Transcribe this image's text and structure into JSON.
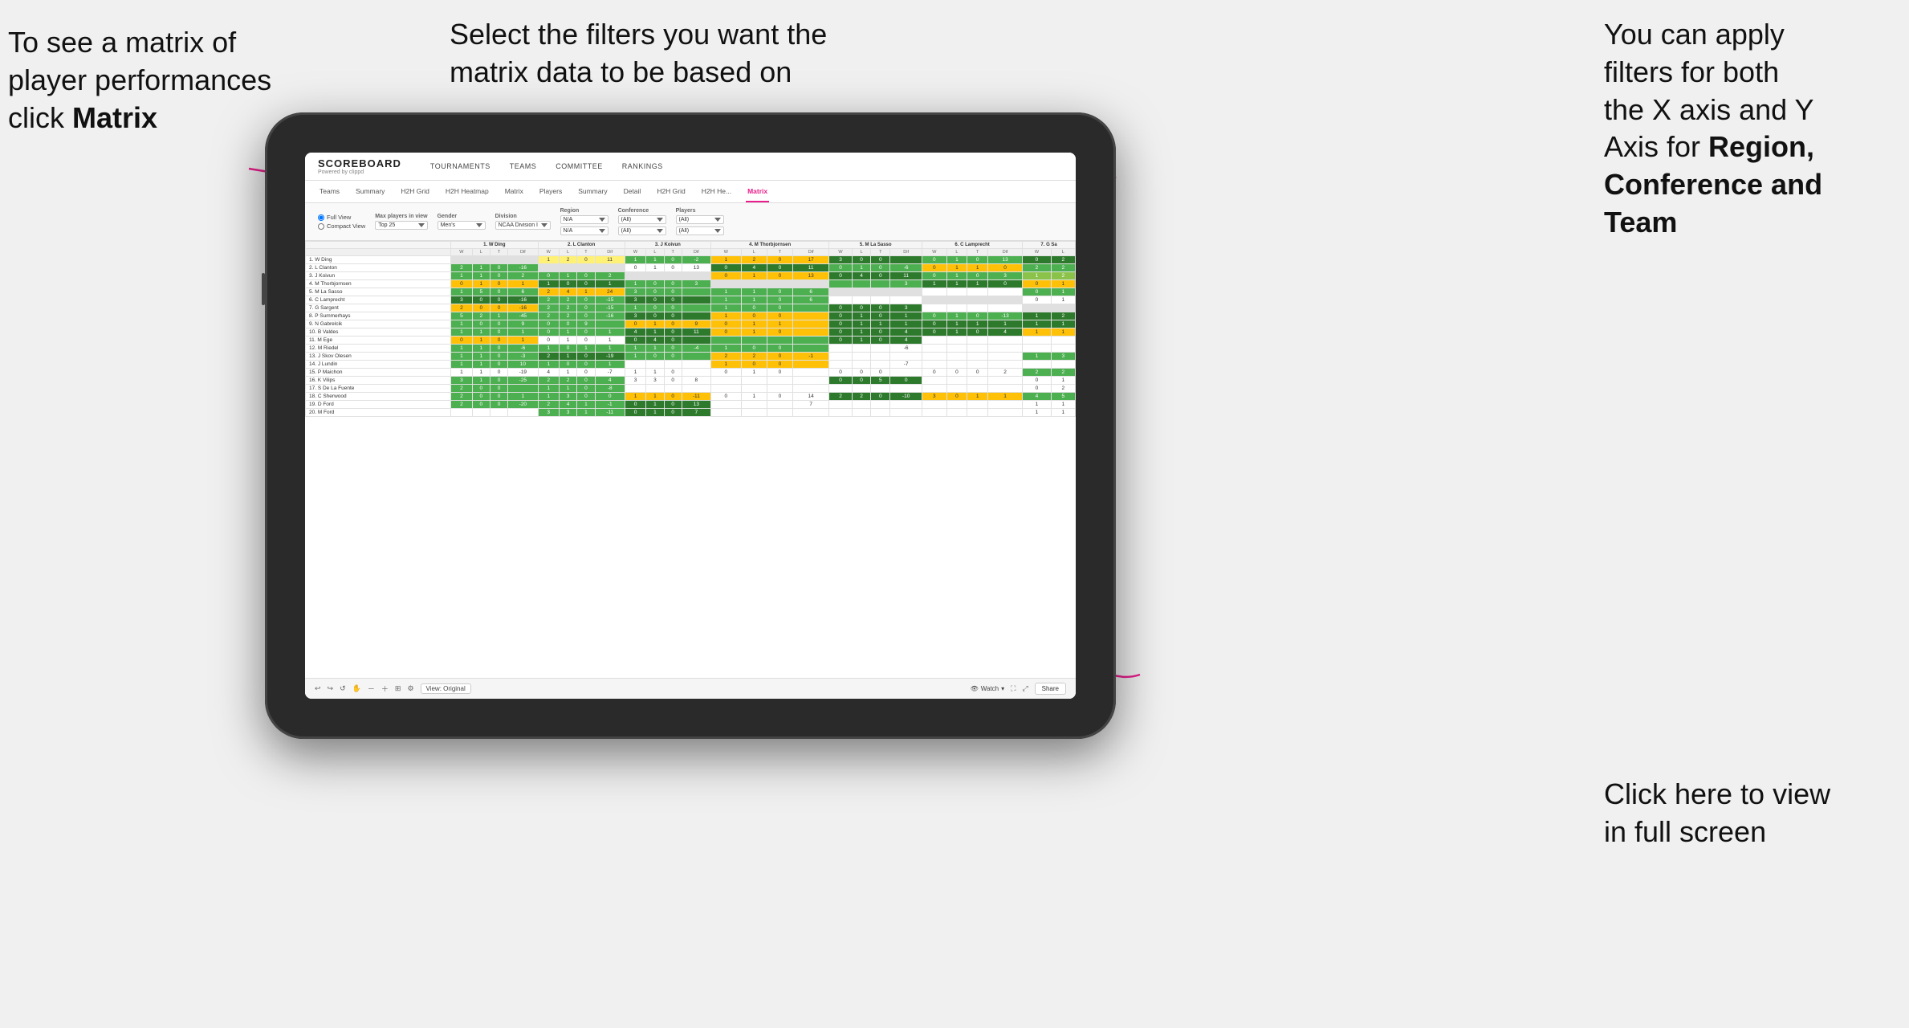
{
  "annotations": {
    "top_left": {
      "line1": "To see a matrix of",
      "line2": "player performances",
      "line3_prefix": "click ",
      "line3_bold": "Matrix"
    },
    "top_center": {
      "text": "Select the filters you want the matrix data to be based on"
    },
    "top_right": {
      "line1": "You  can apply",
      "line2": "filters for both",
      "line3": "the X axis and Y",
      "line4_prefix": "Axis for ",
      "line4_bold": "Region,",
      "line5_bold": "Conference and",
      "line6_bold": "Team"
    },
    "bottom_right": {
      "line1": "Click here to view",
      "line2": "in full screen"
    }
  },
  "nav": {
    "logo": "SCOREBOARD",
    "logo_sub": "Powered by clippd",
    "items": [
      "TOURNAMENTS",
      "TEAMS",
      "COMMITTEE",
      "RANKINGS"
    ]
  },
  "sub_nav": {
    "items": [
      "Teams",
      "Summary",
      "H2H Grid",
      "H2H Heatmap",
      "Matrix",
      "Players",
      "Summary",
      "Detail",
      "H2H Grid",
      "H2H He...",
      "Matrix"
    ],
    "active": "Matrix"
  },
  "filters": {
    "view_options": [
      "Full View",
      "Compact View"
    ],
    "active_view": "Full View",
    "max_players_label": "Max players in view",
    "max_players_value": "Top 25",
    "gender_label": "Gender",
    "gender_value": "Men's",
    "division_label": "Division",
    "division_value": "NCAA Division I",
    "region_label": "Region",
    "region_values": [
      "N/A",
      "N/A"
    ],
    "conference_label": "Conference",
    "conference_values": [
      "(All)",
      "(All)"
    ],
    "players_label": "Players",
    "players_values": [
      "(All)",
      "(All)"
    ]
  },
  "matrix": {
    "col_headers": [
      "1. W Ding",
      "2. L Clanton",
      "3. J Koivun",
      "4. M Thorbjornsen",
      "5. M La Sasso",
      "6. C Lamprecht",
      "7. G Sa"
    ],
    "sub_headers": [
      "W",
      "L",
      "T",
      "Dif"
    ],
    "rows": [
      {
        "name": "1. W Ding"
      },
      {
        "name": "2. L Clanton"
      },
      {
        "name": "3. J Koivun"
      },
      {
        "name": "4. M Thorbjornsen"
      },
      {
        "name": "5. M La Sasso"
      },
      {
        "name": "6. C Lamprecht"
      },
      {
        "name": "7. G Sargent"
      },
      {
        "name": "8. P Summerhays"
      },
      {
        "name": "9. N Gabrelcik"
      },
      {
        "name": "10. B Valdes"
      },
      {
        "name": "11. M Ege"
      },
      {
        "name": "12. M Riedel"
      },
      {
        "name": "13. J Skov Olesen"
      },
      {
        "name": "14. J Lundin"
      },
      {
        "name": "15. P Maichon"
      },
      {
        "name": "16. K Vilips"
      },
      {
        "name": "17. S De La Fuente"
      },
      {
        "name": "18. C Sherwood"
      },
      {
        "name": "19. D Ford"
      },
      {
        "name": "20. M Ford"
      }
    ]
  },
  "bottom_bar": {
    "view_label": "View: Original",
    "watch_label": "Watch",
    "share_label": "Share"
  }
}
